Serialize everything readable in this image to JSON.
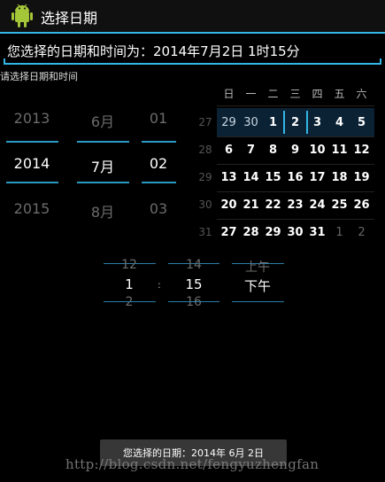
{
  "app_bar": {
    "title": "选择日期",
    "accent": "#33b5e5"
  },
  "result_field": {
    "value": "您选择的日期和时间为：2014年7月2日  1时15分"
  },
  "prompt": "请选择日期和时间",
  "date_spinner": {
    "year": {
      "prev": "2013",
      "current": "2014",
      "next": "2015"
    },
    "month": {
      "prev": "6月",
      "current": "7月",
      "next": "8月"
    },
    "day": {
      "prev": "01",
      "current": "02",
      "next": "03"
    }
  },
  "calendar": {
    "weekdays": [
      "日",
      "一",
      "二",
      "三",
      "四",
      "五",
      "六"
    ],
    "weeks": [
      {
        "num": "27",
        "days": [
          "29",
          "30",
          "1",
          "2",
          "3",
          "4",
          "5"
        ]
      },
      {
        "num": "28",
        "days": [
          "6",
          "7",
          "8",
          "9",
          "10",
          "11",
          "12"
        ]
      },
      {
        "num": "29",
        "days": [
          "13",
          "14",
          "15",
          "16",
          "17",
          "18",
          "19"
        ]
      },
      {
        "num": "30",
        "days": [
          "20",
          "21",
          "22",
          "23",
          "24",
          "25",
          "26"
        ]
      },
      {
        "num": "31",
        "days": [
          "27",
          "28",
          "29",
          "30",
          "31",
          "1",
          "2"
        ]
      }
    ],
    "selected_day": "2"
  },
  "time_spinner": {
    "hour": {
      "prev": "12",
      "current": "1",
      "next": "2"
    },
    "separator": ":",
    "minute": {
      "prev": "14",
      "current": "15",
      "next": "16"
    },
    "ampm": {
      "prev": "上午",
      "current": "下午"
    }
  },
  "toast": {
    "text": "您选择的日期：2014年 6月 2日"
  },
  "watermark": "http://blog.csdn.net/fengyuzhengfan"
}
